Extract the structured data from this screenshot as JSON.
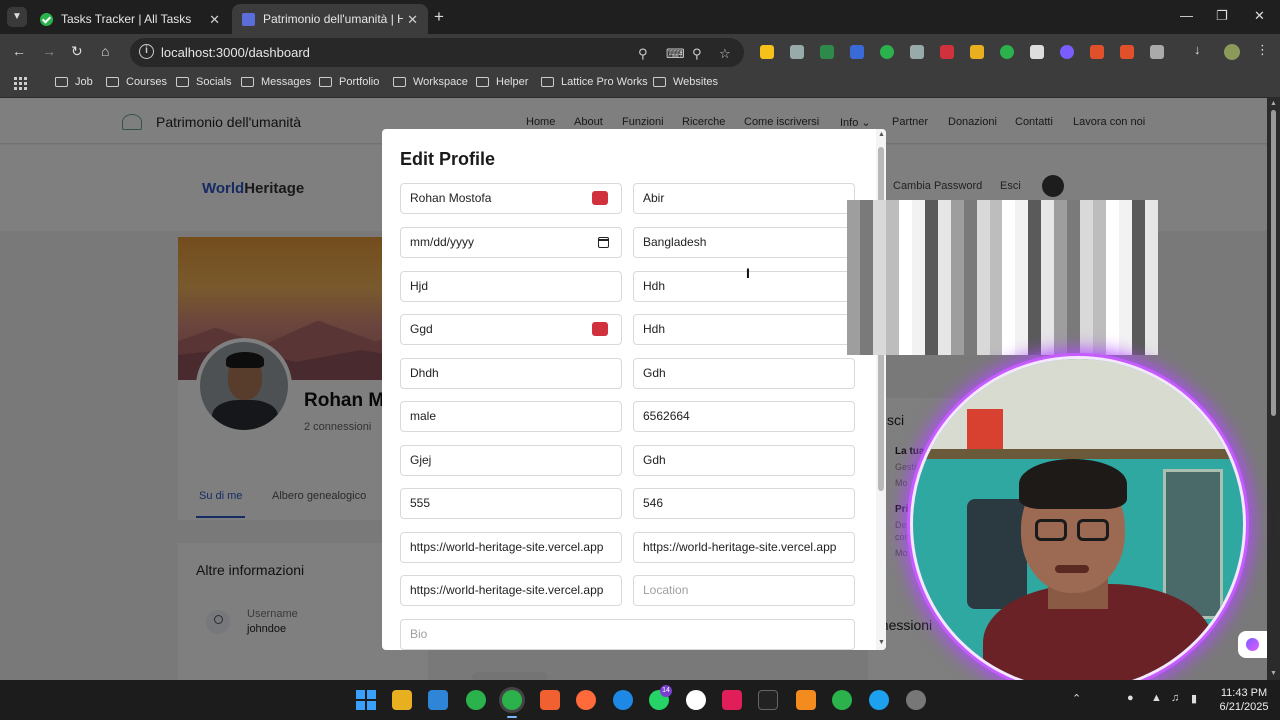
{
  "browser": {
    "tabs": [
      {
        "title": "Tasks Tracker | All Tasks",
        "active": false
      },
      {
        "title": "Patrimonio dell'umanità | Herita",
        "active": true
      }
    ],
    "url": "localhost:3000/dashboard",
    "bookmarks": [
      "Job",
      "Courses",
      "Socials",
      "Messages",
      "Portfolio",
      "Workspace",
      "Helper",
      "Lattice Pro Works",
      "Websites"
    ]
  },
  "site": {
    "name": "Patrimonio dell'umanità",
    "nav": [
      "Home",
      "About",
      "Funzioni",
      "Ricerche",
      "Come iscriversi",
      "Info",
      "Partner",
      "Donazioni",
      "Contatti",
      "Lavora con noi"
    ],
    "logo_world": "World",
    "logo_heritage": "Heritage",
    "account_links": [
      "Cambia Password",
      "Esci"
    ]
  },
  "profile": {
    "name": "Rohan Mo",
    "connections": "2 connessioni",
    "tabs": [
      "Su di me",
      "Albero genealogico"
    ],
    "info_title": "Altre informazioni",
    "username_label": "Username",
    "username_value": "johndoe"
  },
  "sidebar": {
    "stats_title": "stisci",
    "items": [
      {
        "title": "La tua",
        "sub1": "Gestis",
        "sub2": "Mo"
      },
      {
        "title": "Priv",
        "sub1": "Del",
        "sub2": "con",
        "sub3": "Mo"
      }
    ],
    "connections_title": "nnessioni"
  },
  "modal": {
    "title": "Edit Profile",
    "fields_left": [
      {
        "value": "Rohan Mostofa",
        "placeholder": false
      },
      {
        "value": "mm/dd/yyyy",
        "placeholder": false
      },
      {
        "value": "Hjd",
        "placeholder": false
      },
      {
        "value": "Ggd",
        "placeholder": false
      },
      {
        "value": "Dhdh",
        "placeholder": false
      },
      {
        "value": "male",
        "placeholder": false
      },
      {
        "value": "Gjej",
        "placeholder": false
      },
      {
        "value": "555",
        "placeholder": false
      },
      {
        "value": "https://world-heritage-site.vercel.app",
        "placeholder": false
      },
      {
        "value": "https://world-heritage-site.vercel.app",
        "placeholder": false
      }
    ],
    "fields_right": [
      {
        "value": "Abir",
        "placeholder": false
      },
      {
        "value": "Bangladesh",
        "placeholder": false
      },
      {
        "value": "Hdh",
        "placeholder": false
      },
      {
        "value": "Hdh",
        "placeholder": false
      },
      {
        "value": "Gdh",
        "placeholder": false
      },
      {
        "value": "6562664",
        "placeholder": false
      },
      {
        "value": "Gdh",
        "placeholder": false
      },
      {
        "value": "546",
        "placeholder": false
      },
      {
        "value": "https://world-heritage-site.vercel.app",
        "placeholder": false
      },
      {
        "value": "Location",
        "placeholder": true
      }
    ],
    "bio_placeholder": "Bio"
  },
  "taskbar": {
    "time": "11:43 PM",
    "date": "6/21/2025"
  },
  "colors": {
    "accent": "#2c56c7",
    "password_icon": "#d0313d",
    "cam_glow": "#c65cff"
  }
}
